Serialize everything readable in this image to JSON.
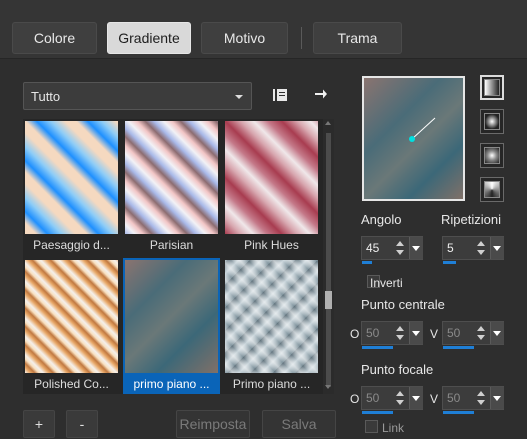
{
  "tabs": [
    {
      "label": "Colore"
    },
    {
      "label": "Gradiente"
    },
    {
      "label": "Motivo"
    },
    {
      "label": "Trama"
    }
  ],
  "category_select": {
    "value": "Tutto"
  },
  "icons": {
    "library": "library-book-icon",
    "export": "arrow-right-icon"
  },
  "gradients": [
    {
      "label": "Paesaggio d..."
    },
    {
      "label": "Parisian"
    },
    {
      "label": "Pink Hues"
    },
    {
      "label": "Polished Co..."
    },
    {
      "label": "primo piano ..."
    },
    {
      "label": "Primo piano ..."
    }
  ],
  "bottom_buttons": {
    "add": "+",
    "remove": "-",
    "reset": "Reimposta",
    "save": "Salva"
  },
  "angle": {
    "label": "Angolo",
    "value": "45"
  },
  "repeats": {
    "label": "Ripetizioni",
    "value": "5"
  },
  "invert": {
    "label": "Inverti"
  },
  "center_point": {
    "label": "Punto centrale",
    "h_label": "O",
    "h_value": "50",
    "v_label": "V",
    "v_value": "50"
  },
  "focal_point": {
    "label": "Punto focale",
    "h_label": "O",
    "h_value": "50",
    "v_label": "V",
    "v_value": "50"
  },
  "link": {
    "label": "Link"
  },
  "colors": {
    "accent": "#1f7fd6",
    "selection": "#0a64b8",
    "background": "#2e2e2e"
  }
}
